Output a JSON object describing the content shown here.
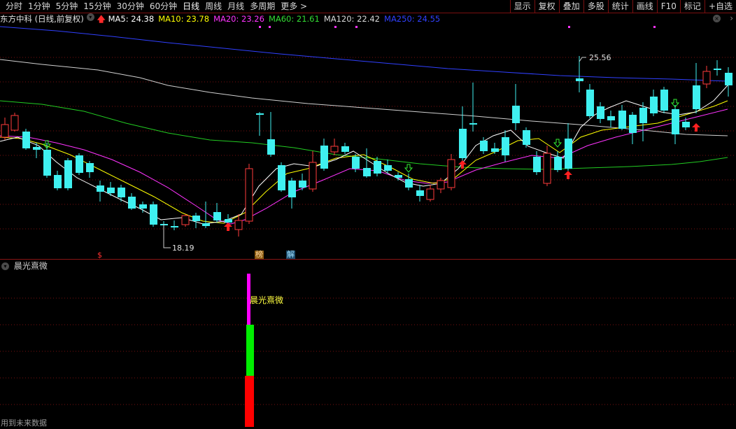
{
  "toolbar": {
    "tabs": [
      "分时",
      "1分钟",
      "5分钟",
      "15分钟",
      "30分钟",
      "60分钟",
      "日线",
      "周线",
      "月线",
      "多周期",
      "更多 >"
    ],
    "active_tab": "日线",
    "tools": [
      "显示",
      "复权",
      "叠加",
      "多股",
      "统计",
      "画线",
      "F10",
      "标记",
      "+自选"
    ]
  },
  "info": {
    "stock": "东方中科 (日线,前复权)",
    "ma5": "MA5: 24.38",
    "ma10": "MA10: 23.78",
    "ma20": "MA20: 23.26",
    "ma60": "MA60: 21.61",
    "ma120": "MA120: 22.42",
    "ma250": "MA250: 24.55",
    "close_glyph": "×",
    "nav_glyph": "›"
  },
  "colors": {
    "up": "#ff3b3b",
    "down": "#3ff0f0",
    "ma5": "#ffffff",
    "ma10": "#ffff00",
    "ma20": "#ff33ff",
    "ma60": "#33dd33",
    "ma120": "#d8d8d8",
    "ma250": "#3040ff",
    "grid": "#7a1010"
  },
  "annotations": {
    "high_price": "25.56",
    "low_price": "18.19",
    "badge_bang": "榜",
    "badge_jie": "解",
    "badge_dollar": "$"
  },
  "indicator": {
    "name": "晨光熹微",
    "label": "晨光熹微",
    "bar_colors": [
      "#ff00ff",
      "#00ee00",
      "#ff0000"
    ]
  },
  "footer": "用到未来数据",
  "chart_data": {
    "type": "candlestick",
    "high": 25.56,
    "low": 18.19,
    "ma_latest": {
      "MA5": 24.38,
      "MA10": 23.78,
      "MA20": 23.26,
      "MA60": 21.61,
      "MA120": 22.42,
      "MA250": 24.55
    }
  }
}
